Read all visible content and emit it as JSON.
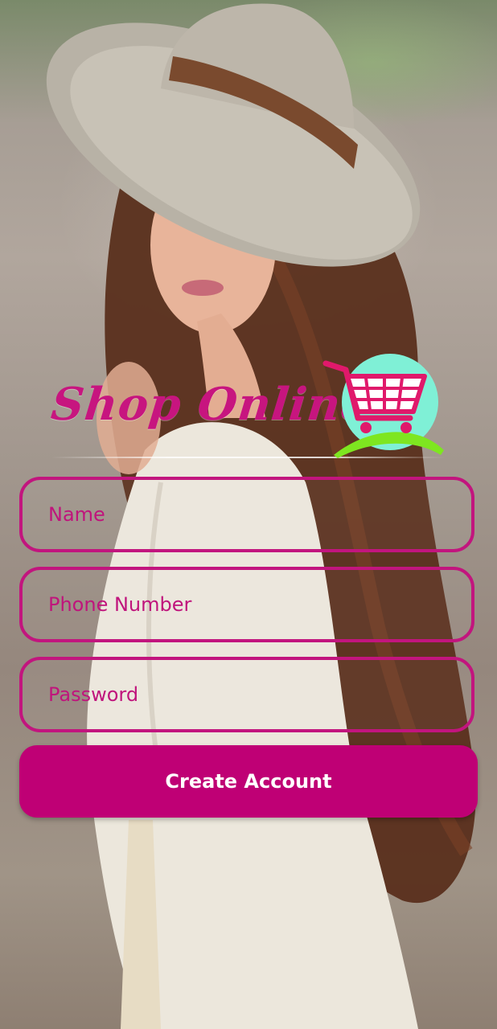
{
  "app": {
    "brand": "Shop Online"
  },
  "form": {
    "name_placeholder": "Name",
    "phone_placeholder": "Phone Number",
    "password_placeholder": "Password",
    "create_button_label": "Create Account"
  },
  "colors": {
    "accent": "#c2157e",
    "button": "#bf0075",
    "button_text": "#ffffff",
    "logo_circle": "#7ff0d6",
    "logo_arc": "#7ee620"
  },
  "icons": {
    "logo_icon": "shopping-cart-icon"
  }
}
